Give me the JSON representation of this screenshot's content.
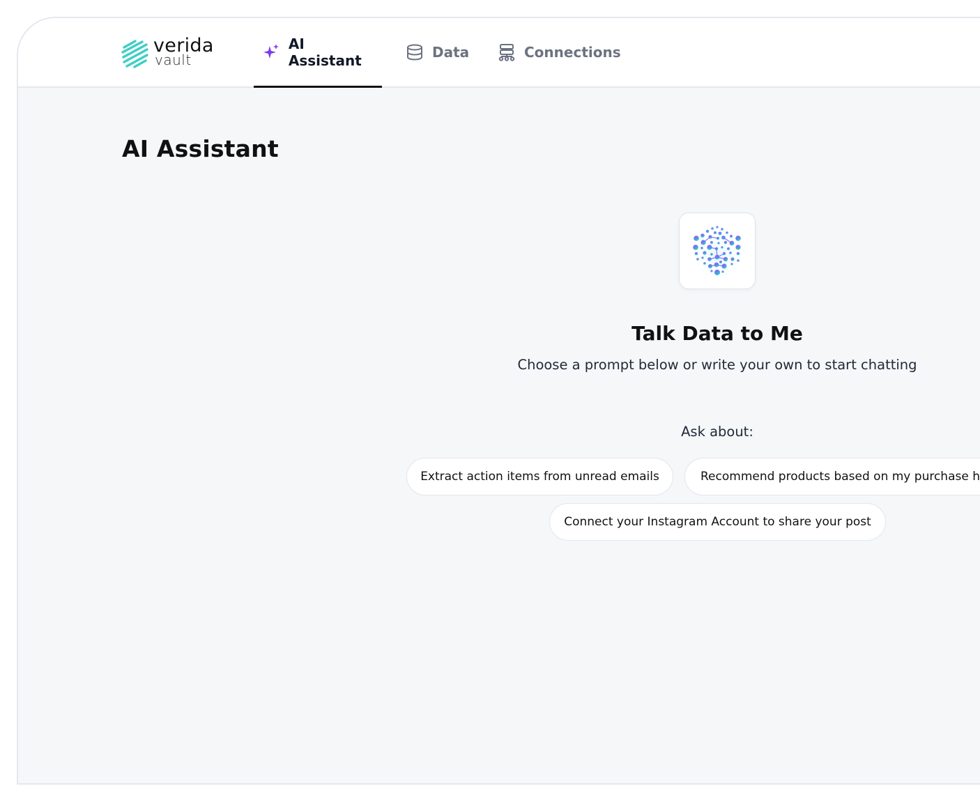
{
  "brand": {
    "name_line1": "verida",
    "name_line2": "vault",
    "accent_color": "#3ecfc4"
  },
  "nav": {
    "tabs": [
      {
        "label": "AI Assistant",
        "icon": "sparkle-icon",
        "active": true
      },
      {
        "label": "Data",
        "icon": "database-icon",
        "active": false
      },
      {
        "label": "Connections",
        "icon": "connections-icon",
        "active": false
      }
    ]
  },
  "page": {
    "title": "AI Assistant"
  },
  "assistant": {
    "icon": "ai-orb-icon",
    "heading": "Talk Data to Me",
    "subheading": "Choose a prompt below or write your own to start chatting",
    "ask_label": "Ask about:",
    "prompts": [
      "Extract action items from unread emails",
      "Recommend products based on my purchase history",
      "Connect your Instagram Account to share your post"
    ]
  },
  "colors": {
    "sparkle": "#7c3aed",
    "page_bg": "#f5f7f9",
    "active_tab_underline": "#111111"
  }
}
